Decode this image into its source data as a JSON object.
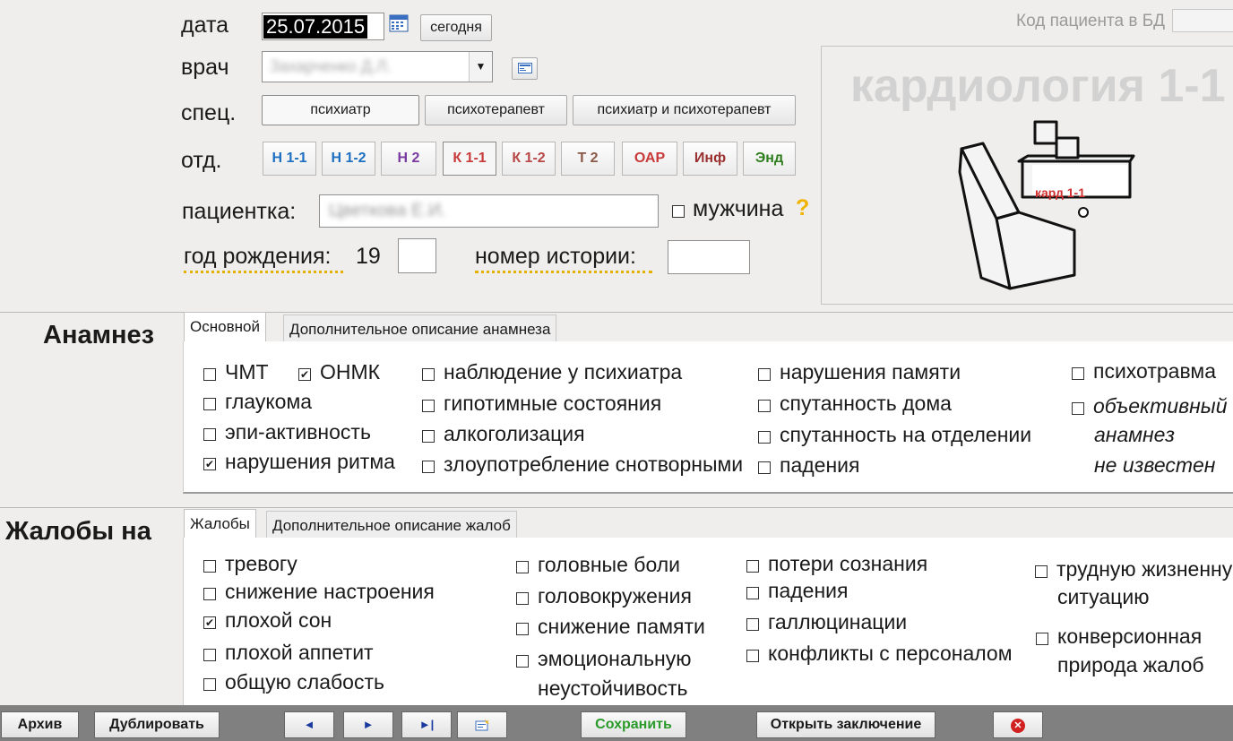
{
  "header": {
    "date_label": "дата",
    "date_value": "25.07.2015",
    "today_button": "сегодня",
    "doctor_label": "врач",
    "doctor_value": "Захарченко Д.Л.",
    "spec_label": "спец.",
    "spec_options": [
      "психиатр",
      "психотерапевт",
      "психиатр и психотерапевт"
    ],
    "dept_label": "отд.",
    "depts": [
      {
        "label": "Н 1-1",
        "color": "#1e6fc0"
      },
      {
        "label": "Н 1-2",
        "color": "#1e6fc0"
      },
      {
        "label": "Н 2",
        "color": "#7a3ba0"
      },
      {
        "label": "К 1-1",
        "color": "#c83a3a"
      },
      {
        "label": "К 1-2",
        "color": "#b84848"
      },
      {
        "label": "Т 2",
        "color": "#8a5a4a"
      },
      {
        "label": "ОАР",
        "color": "#c83a3a"
      },
      {
        "label": "Инф",
        "color": "#9a3030"
      },
      {
        "label": "Энд",
        "color": "#2e7d1e"
      }
    ],
    "patient_label": "пациентка:",
    "patient_value": "Цветкова Е.И.",
    "male_label": "мужчина",
    "question_mark": "?",
    "birth_label": "год рождения:",
    "birth_prefix": "19",
    "history_label": "номер истории:",
    "patient_db_label": "Код пациента в БД"
  },
  "ward_panel": {
    "title": "кардиология 1-1",
    "map_label": "кард 1-1"
  },
  "anamnesis": {
    "heading": "Анамнез",
    "tabs": [
      "Основной",
      "Дополнительное описание анамнеза"
    ],
    "items": [
      {
        "label": "ЧМТ",
        "checked": false
      },
      {
        "label": "ОНМК",
        "checked": true
      },
      {
        "label": "глаукома",
        "checked": false
      },
      {
        "label": "эпи-активность",
        "checked": false
      },
      {
        "label": "нарушения ритма",
        "checked": true
      },
      {
        "label": "наблюдение у психиатра",
        "checked": false
      },
      {
        "label": "гипотимные состояния",
        "checked": false
      },
      {
        "label": "алкоголизация",
        "checked": false
      },
      {
        "label": "злоупотребление снотворными",
        "checked": false
      },
      {
        "label": "нарушения памяти",
        "checked": false
      },
      {
        "label": "спутанность дома",
        "checked": false
      },
      {
        "label": "спутанность на отделении",
        "checked": false
      },
      {
        "label": "падения",
        "checked": false
      },
      {
        "label": "психотравма",
        "checked": false
      },
      {
        "label": "объективный",
        "checked": false
      }
    ],
    "objective_line2": "анамнез",
    "objective_line3": "не известен"
  },
  "complaints": {
    "heading": "Жалобы на",
    "tabs": [
      "Жалобы",
      "Дополнительное описание жалоб"
    ],
    "items": [
      {
        "label": "тревогу",
        "checked": false
      },
      {
        "label": "снижение настроения",
        "checked": false
      },
      {
        "label": "плохой сон",
        "checked": true
      },
      {
        "label": "плохой аппетит",
        "checked": false
      },
      {
        "label": "общую слабость",
        "checked": false
      },
      {
        "label": "головные боли",
        "checked": false
      },
      {
        "label": "головокружения",
        "checked": false
      },
      {
        "label": "снижение памяти",
        "checked": false
      },
      {
        "label": "эмоциональную",
        "checked": false
      },
      {
        "label": "потери сознания",
        "checked": false
      },
      {
        "label": "падения",
        "checked": false
      },
      {
        "label": "галлюцинации",
        "checked": false
      },
      {
        "label": "конфликты с персоналом",
        "checked": false
      },
      {
        "label": "трудную жизненну",
        "checked": false
      },
      {
        "label": "конверсионная",
        "checked": false
      }
    ],
    "emotional_line2": "неустойчивость",
    "hard_line2": "ситуацию",
    "conversion_line2": "природа жалоб"
  },
  "footer": {
    "archive": "Архив",
    "duplicate": "Дублировать",
    "prev": "◄",
    "next": "►",
    "last": "►|",
    "save": "Сохранить",
    "open_conclusion": "Открыть заключение",
    "close": "✕",
    "save_color": "#2a9a2a"
  }
}
